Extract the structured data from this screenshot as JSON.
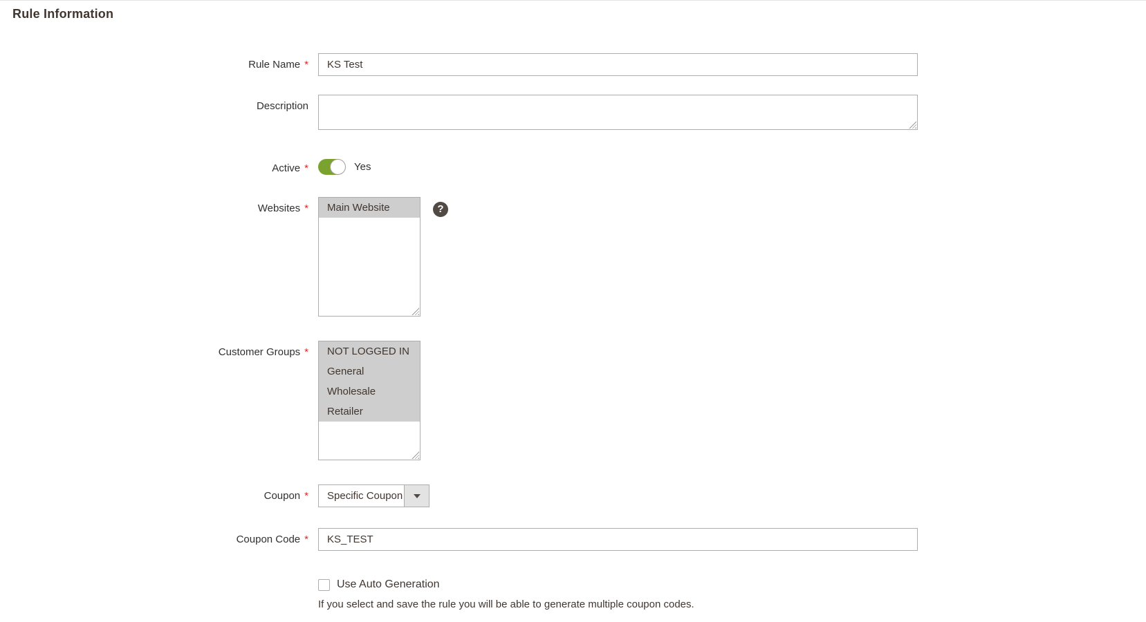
{
  "page": {
    "title": "Rule Information"
  },
  "form": {
    "rule_name": {
      "label": "Rule Name",
      "required": "*",
      "value": "KS Test"
    },
    "description": {
      "label": "Description",
      "value": ""
    },
    "active": {
      "label": "Active",
      "required": "*",
      "state": "Yes",
      "enabled": true
    },
    "websites": {
      "label": "Websites",
      "required": "*",
      "options": [
        {
          "label": "Main Website",
          "selected": true
        }
      ]
    },
    "customer_groups": {
      "label": "Customer Groups",
      "required": "*",
      "options": [
        {
          "label": "NOT LOGGED IN",
          "selected": true
        },
        {
          "label": "General",
          "selected": true
        },
        {
          "label": "Wholesale",
          "selected": true
        },
        {
          "label": "Retailer",
          "selected": true
        }
      ]
    },
    "coupon": {
      "label": "Coupon",
      "required": "*",
      "selected_value": "Specific Coupon"
    },
    "coupon_code": {
      "label": "Coupon Code",
      "required": "*",
      "value": "KS_TEST"
    },
    "use_auto_generation": {
      "label": "Use Auto Generation",
      "checked": false,
      "note": "If you select and save the rule you will be able to generate multiple coupon codes."
    }
  },
  "icons": {
    "help": "?",
    "dropdown_arrow": "caret-down"
  },
  "colors": {
    "toggle_active_green": "#79a22e",
    "required_red": "#e22626",
    "input_border": "#adadad",
    "selected_option_bg": "#cecece",
    "help_icon_bg": "#514943",
    "text": "#41362f"
  }
}
